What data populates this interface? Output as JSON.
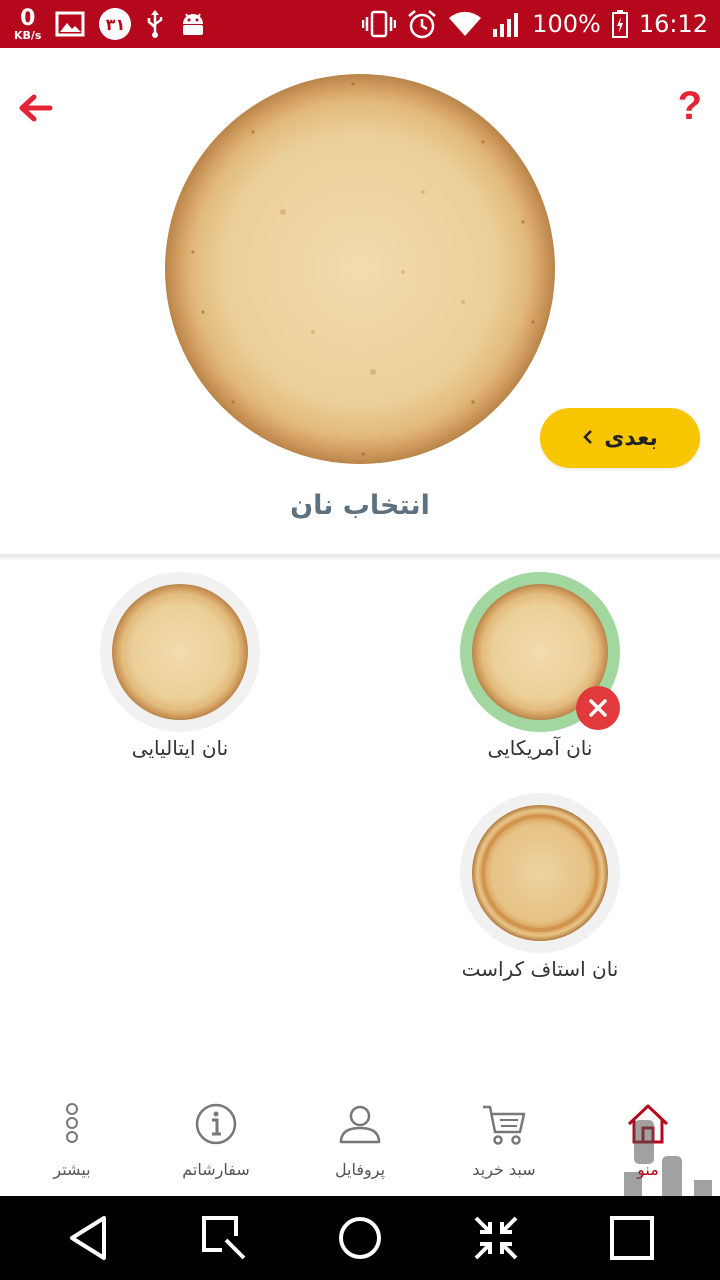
{
  "status_bar": {
    "net_speed_value": "0",
    "net_speed_unit": "KB/s",
    "calendar_day": "۳۱",
    "battery": "100%",
    "time": "16:12",
    "background": "#b5081d"
  },
  "header": {
    "help_label": "?",
    "next_label": "بعدی",
    "next_color": "#f7c600"
  },
  "section_title": "انتخاب نان",
  "options": [
    {
      "label": "نان آمریکایی",
      "selected": true
    },
    {
      "label": "نان ایتالیایی",
      "selected": false
    },
    {
      "label": "نان استاف کراست",
      "selected": false
    }
  ],
  "bottom_nav": [
    {
      "label": "منو",
      "icon": "home-icon",
      "active": true
    },
    {
      "label": "سبد خرید",
      "icon": "cart-icon",
      "active": false
    },
    {
      "label": "پروفایل",
      "icon": "profile-icon",
      "active": false
    },
    {
      "label": "سفارشاتم",
      "icon": "info-icon",
      "active": false
    },
    {
      "label": "بیشتر",
      "icon": "more-icon",
      "active": false
    }
  ],
  "accent_color": "#e22434",
  "selected_ring_color": "#a2d79f"
}
